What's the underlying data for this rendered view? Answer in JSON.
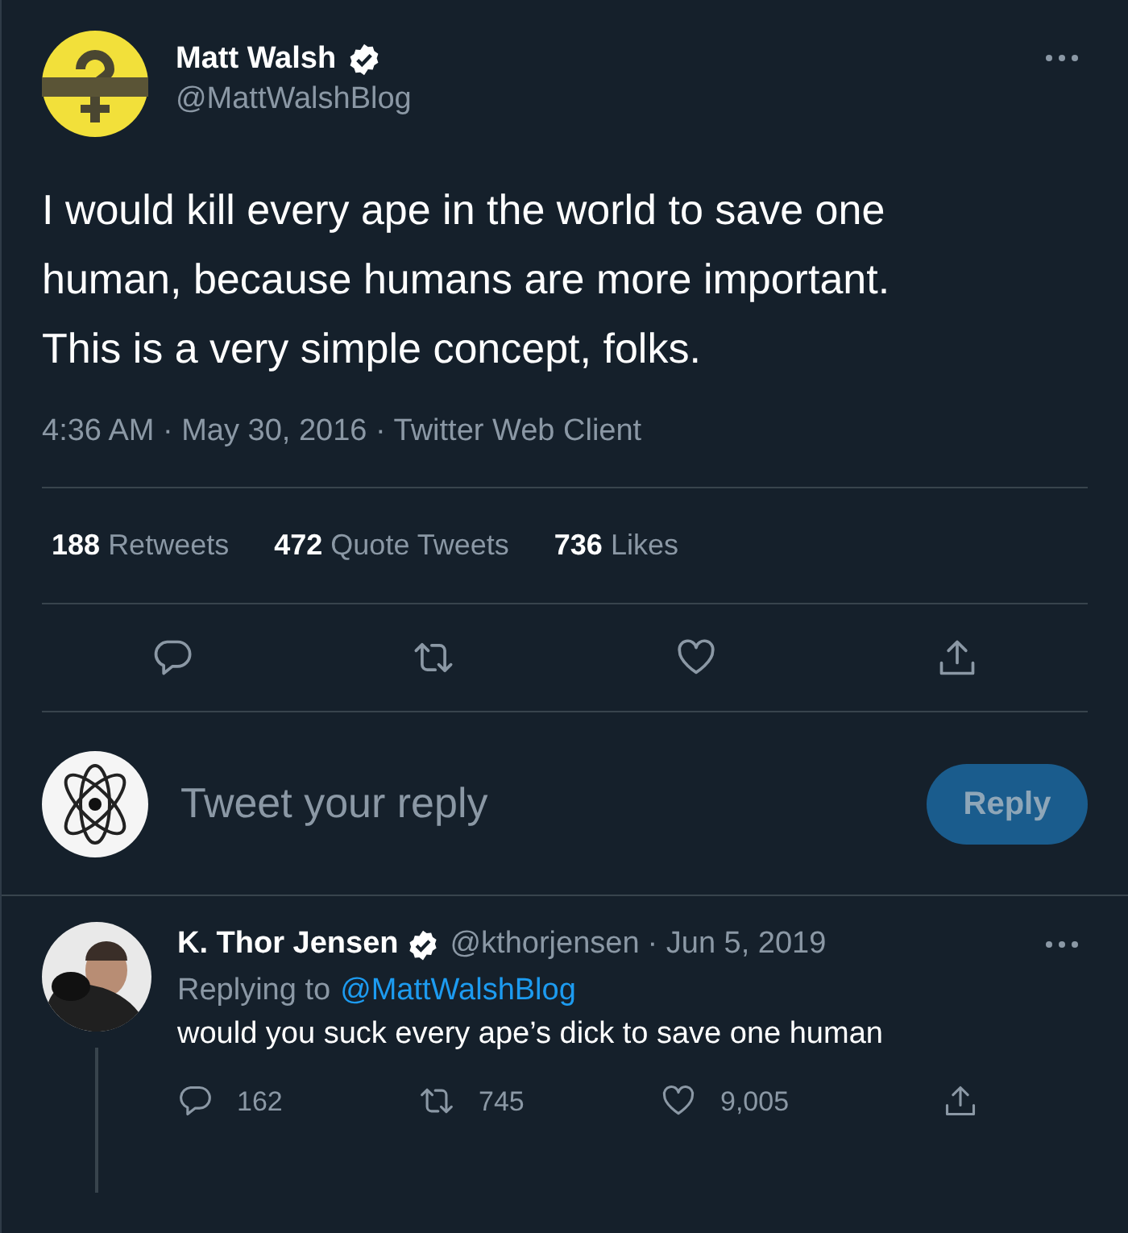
{
  "tweet": {
    "name": "Matt Walsh",
    "verified": true,
    "handle": "@MattWalshBlog",
    "text": "I would kill every ape in the world to save one human, because humans are more important. This is a very simple concept, folks.",
    "meta": "4:36 AM · May 30, 2016 · Twitter Web Client",
    "stats": [
      {
        "count": "188",
        "label": "Retweets"
      },
      {
        "count": "472",
        "label": "Quote Tweets"
      },
      {
        "count": "736",
        "label": "Likes"
      }
    ]
  },
  "composer": {
    "placeholder": "Tweet your reply",
    "button": "Reply"
  },
  "reply": {
    "name": "K. Thor Jensen",
    "verified": true,
    "handle": "@kthorjensen",
    "date": "· Jun 5, 2019",
    "replying_prefix": "Replying to",
    "replying_to": "@MattWalshBlog",
    "text": "would you suck every ape’s dick to save one human",
    "counts": {
      "replies": "162",
      "retweets": "745",
      "likes": "9,005"
    }
  }
}
